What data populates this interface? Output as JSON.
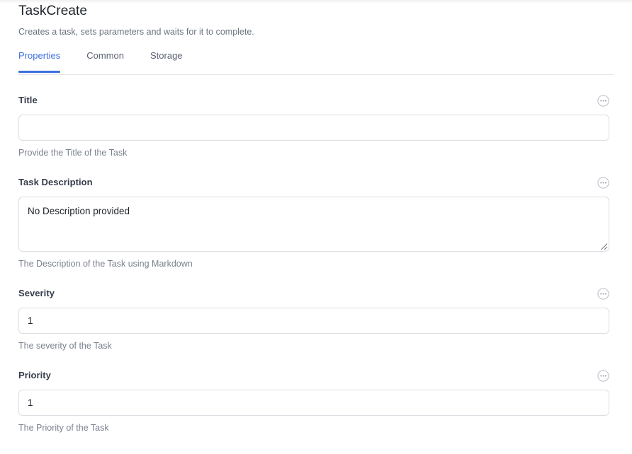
{
  "header": {
    "title": "TaskCreate",
    "subtitle": "Creates a task, sets parameters and waits for it to complete."
  },
  "tabs": [
    {
      "label": "Properties",
      "active": true
    },
    {
      "label": "Common",
      "active": false
    },
    {
      "label": "Storage",
      "active": false
    }
  ],
  "fields": [
    {
      "label": "Title",
      "type": "input",
      "value": "",
      "placeholder": "",
      "help": "Provide the Title of the Task",
      "options_icon": "ellipsis-circle-icon"
    },
    {
      "label": "Task Description",
      "type": "textarea",
      "value": "No Description provided",
      "placeholder": "",
      "help": "The Description of the Task using Markdown",
      "options_icon": "ellipsis-circle-icon"
    },
    {
      "label": "Severity",
      "type": "input",
      "value": "1",
      "placeholder": "",
      "help": "The severity of the Task",
      "options_icon": "ellipsis-circle-icon"
    },
    {
      "label": "Priority",
      "type": "input",
      "value": "1",
      "placeholder": "",
      "help": "The Priority of the Task",
      "options_icon": "ellipsis-circle-icon"
    }
  ],
  "colors": {
    "accent": "#3b6fe0",
    "label": "#353b4a",
    "help": "#7b818d",
    "border": "#dcdee3",
    "divider": "#e4e5e8",
    "background": "#ffffff"
  }
}
